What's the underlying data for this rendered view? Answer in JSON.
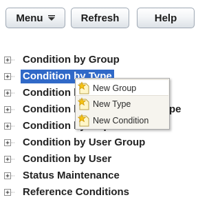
{
  "toolbar": {
    "menu_label": "Menu",
    "refresh_label": "Refresh",
    "help_label": "Help"
  },
  "tree": {
    "selected_index": 1,
    "items": [
      {
        "label": "Condition by Group"
      },
      {
        "label": "Condition by Type"
      },
      {
        "label": "Condition by I"
      },
      {
        "label": "Condition by A"
      },
      {
        "label": "Condition by Inspection"
      },
      {
        "label": "Condition by User Group"
      },
      {
        "label": "Condition by User"
      },
      {
        "label": "Status Maintenance"
      },
      {
        "label": "Reference Conditions"
      }
    ],
    "occluded_suffix_row3": "pe"
  },
  "context_menu": {
    "items": [
      {
        "label": "New Group",
        "icon": "new-star-icon"
      },
      {
        "label": "New Type",
        "icon": "new-star-icon"
      },
      {
        "label": "New Condition",
        "icon": "new-star-icon"
      }
    ],
    "hovered_index": 0
  },
  "colors": {
    "selection": "#3069c8",
    "menu_background": "#f6f4ee",
    "button_border": "#9da7b3"
  }
}
